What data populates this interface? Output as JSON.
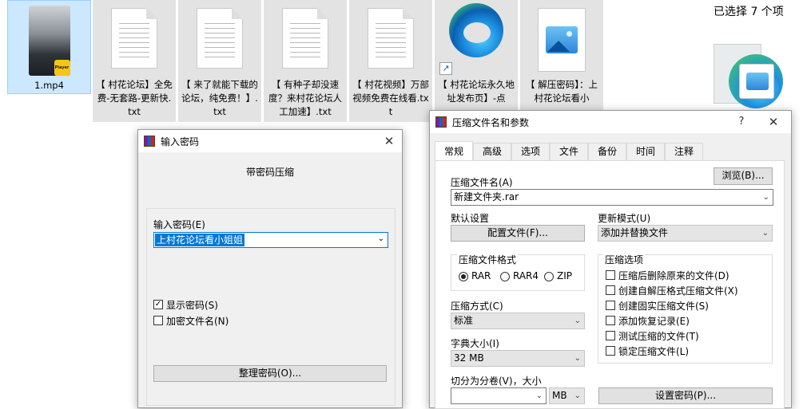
{
  "explorer": {
    "files": [
      {
        "name": "1.mp4",
        "kind": "video",
        "badge": "Player"
      },
      {
        "name": "【 村花论坛】全免费-无套路-更新快.txt",
        "kind": "txt"
      },
      {
        "name": "【 来了就能下载的论坛，纯免费！】.txt",
        "kind": "txt"
      },
      {
        "name": "【 有种子却没速度？来村花论坛人工加速】.txt",
        "kind": "txt"
      },
      {
        "name": "【 村花视频】万部视频免费在线看.txt",
        "kind": "txt"
      },
      {
        "name": "【 村花论坛永久地址发布页】-点",
        "kind": "edge-shortcut"
      },
      {
        "name": "【 解压密码】：上村花论坛看小",
        "kind": "image"
      }
    ],
    "details": {
      "selected_count": "已选择 7 个项"
    }
  },
  "password_dialog": {
    "title": "输入密码",
    "heading": "带密码压缩",
    "password_label": "输入密码(E)",
    "password_value": "上村花论坛看小姐姐",
    "show_password_label": "显示密码(S)",
    "show_password_checked": true,
    "encrypt_names_label": "加密文件名(N)",
    "encrypt_names_checked": false,
    "organize_button": "整理密码(O)...",
    "close_glyph": "✕"
  },
  "archive_dialog": {
    "title": "压缩文件名和参数",
    "help_glyph": "?",
    "close_glyph": "✕",
    "tabs": [
      "常规",
      "高级",
      "选项",
      "文件",
      "备份",
      "时间",
      "注释"
    ],
    "active_tab": "常规",
    "archive_name_label": "压缩文件名(A)",
    "browse_button": "浏览(B)...",
    "archive_name_value": "新建文件夹.rar",
    "default_settings_label": "默认设置",
    "profiles_button": "配置文件(F)...",
    "update_mode_label": "更新模式(U)",
    "update_mode_value": "添加并替换文件",
    "format_group_label": "压缩文件格式",
    "formats": [
      {
        "label": "RAR",
        "selected": true
      },
      {
        "label": "RAR4",
        "selected": false
      },
      {
        "label": "ZIP",
        "selected": false
      }
    ],
    "method_label": "压缩方式(C)",
    "method_value": "标准",
    "dict_label": "字典大小(I)",
    "dict_value": "32 MB",
    "split_label": "切分为分卷(V)，大小",
    "split_value": "",
    "split_unit": "MB",
    "options_group_label": "压缩选项",
    "options": [
      {
        "label": "压缩后删除原来的文件(D)",
        "checked": false
      },
      {
        "label": "创建自解压格式压缩文件(X)",
        "checked": false
      },
      {
        "label": "创建固实压缩文件(S)",
        "checked": false
      },
      {
        "label": "添加恢复记录(E)",
        "checked": false
      },
      {
        "label": "测试压缩的文件(T)",
        "checked": false
      },
      {
        "label": "锁定压缩文件(L)",
        "checked": false
      }
    ],
    "set_password_button": "设置密码(P)..."
  }
}
